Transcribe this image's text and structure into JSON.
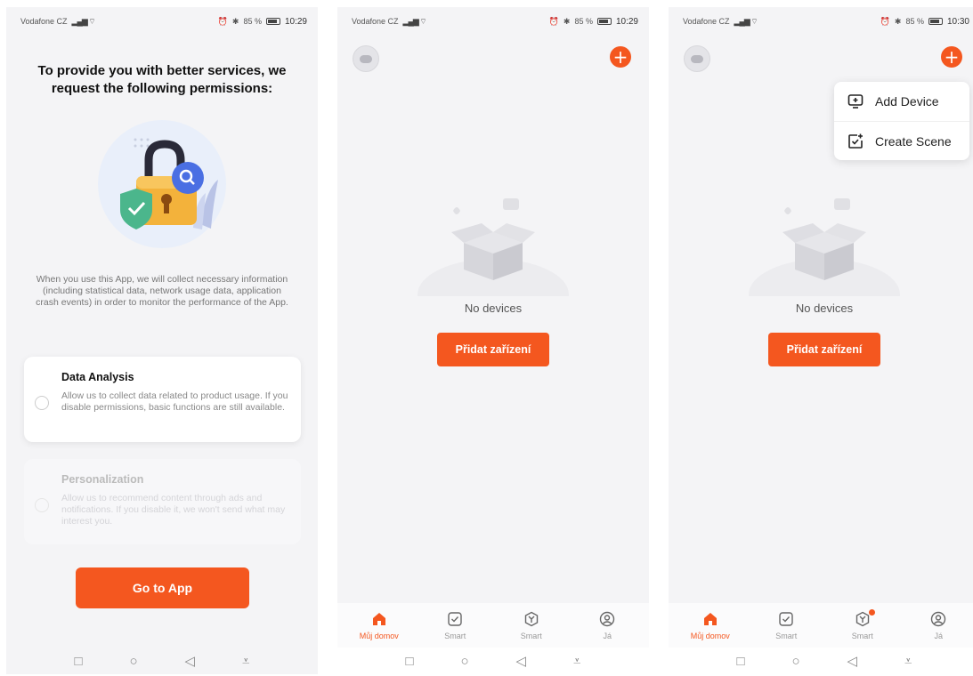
{
  "status_bars": [
    {
      "carrier": "Vodafone CZ",
      "battery": "85 %",
      "time": "10:29"
    },
    {
      "carrier": "Vodafone CZ",
      "battery": "85 %",
      "time": "10:29"
    },
    {
      "carrier": "Vodafone CZ",
      "battery": "85 %",
      "time": "10:30"
    }
  ],
  "permissions": {
    "title": "To provide you with better services, we request the following permissions:",
    "description": "When you use this App, we will collect necessary information (including statistical data, network usage data, application crash events) in order to monitor the performance of the App.",
    "options": [
      {
        "title": "Data Analysis",
        "text": "Allow us to collect data related to product usage. If you disable permissions, basic functions are still available."
      },
      {
        "title": "Personalization",
        "text": "Allow us to recommend content through ads and notifications. If you disable it, we won't send what may interest you."
      }
    ],
    "go_button": "Go to App"
  },
  "home": {
    "empty_text": "No devices",
    "add_button": "Přidat zařízení",
    "tabs": [
      {
        "label": "Můj domov",
        "icon": "home-icon",
        "active": true
      },
      {
        "label": "Smart",
        "icon": "checkbox-icon",
        "active": false
      },
      {
        "label": "Smart",
        "icon": "scene-icon",
        "active": false
      },
      {
        "label": "Já",
        "icon": "profile-icon",
        "active": false
      }
    ]
  },
  "menu": {
    "items": [
      {
        "label": "Add Device",
        "icon": "add-device-icon"
      },
      {
        "label": "Create Scene",
        "icon": "create-scene-icon"
      }
    ]
  },
  "colors": {
    "accent": "#f4571f",
    "background": "#f4f4f6"
  }
}
